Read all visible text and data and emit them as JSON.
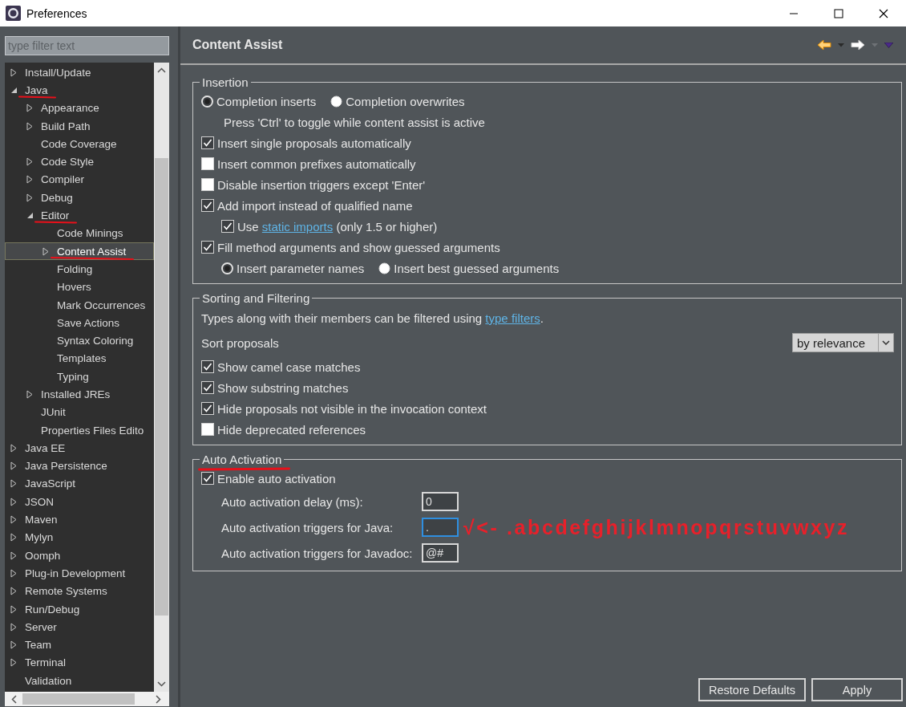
{
  "window": {
    "title": "Preferences"
  },
  "filter": {
    "placeholder": "type filter text"
  },
  "tree": {
    "items": [
      {
        "label": "Install/Update",
        "kind": "branch",
        "expanded": false,
        "selected": false
      },
      {
        "label": "Java",
        "kind": "branch",
        "expanded": true,
        "selected": false,
        "annotated": true,
        "children": [
          {
            "label": "Appearance",
            "kind": "branch",
            "expanded": false,
            "selected": false
          },
          {
            "label": "Build Path",
            "kind": "branch",
            "expanded": false,
            "selected": false
          },
          {
            "label": "Code Coverage",
            "kind": "leaf",
            "selected": false
          },
          {
            "label": "Code Style",
            "kind": "branch",
            "expanded": false,
            "selected": false
          },
          {
            "label": "Compiler",
            "kind": "branch",
            "expanded": false,
            "selected": false
          },
          {
            "label": "Debug",
            "kind": "branch",
            "expanded": false,
            "selected": false
          },
          {
            "label": "Editor",
            "kind": "branch",
            "expanded": true,
            "selected": false,
            "annotated": true,
            "children": [
              {
                "label": "Code Minings",
                "kind": "leaf",
                "selected": false
              },
              {
                "label": "Content Assist",
                "kind": "branch",
                "expanded": false,
                "selected": true,
                "annotated": true
              },
              {
                "label": "Folding",
                "kind": "leaf",
                "selected": false
              },
              {
                "label": "Hovers",
                "kind": "leaf",
                "selected": false
              },
              {
                "label": "Mark Occurrences",
                "kind": "leaf",
                "selected": false
              },
              {
                "label": "Save Actions",
                "kind": "leaf",
                "selected": false
              },
              {
                "label": "Syntax Coloring",
                "kind": "leaf",
                "selected": false
              },
              {
                "label": "Templates",
                "kind": "leaf",
                "selected": false
              },
              {
                "label": "Typing",
                "kind": "leaf",
                "selected": false
              }
            ]
          },
          {
            "label": "Installed JREs",
            "kind": "branch",
            "expanded": false,
            "selected": false
          },
          {
            "label": "JUnit",
            "kind": "leaf",
            "selected": false
          },
          {
            "label": "Properties Files Edito",
            "kind": "leaf",
            "selected": false
          }
        ]
      },
      {
        "label": "Java EE",
        "kind": "branch",
        "expanded": false,
        "selected": false
      },
      {
        "label": "Java Persistence",
        "kind": "branch",
        "expanded": false,
        "selected": false
      },
      {
        "label": "JavaScript",
        "kind": "branch",
        "expanded": false,
        "selected": false
      },
      {
        "label": "JSON",
        "kind": "branch",
        "expanded": false,
        "selected": false
      },
      {
        "label": "Maven",
        "kind": "branch",
        "expanded": false,
        "selected": false
      },
      {
        "label": "Mylyn",
        "kind": "branch",
        "expanded": false,
        "selected": false
      },
      {
        "label": "Oomph",
        "kind": "branch",
        "expanded": false,
        "selected": false
      },
      {
        "label": "Plug-in Development",
        "kind": "branch",
        "expanded": false,
        "selected": false
      },
      {
        "label": "Remote Systems",
        "kind": "branch",
        "expanded": false,
        "selected": false
      },
      {
        "label": "Run/Debug",
        "kind": "branch",
        "expanded": false,
        "selected": false
      },
      {
        "label": "Server",
        "kind": "branch",
        "expanded": false,
        "selected": false
      },
      {
        "label": "Team",
        "kind": "branch",
        "expanded": false,
        "selected": false
      },
      {
        "label": "Terminal",
        "kind": "branch",
        "expanded": false,
        "selected": false
      },
      {
        "label": "Validation",
        "kind": "leaf",
        "selected": false
      }
    ]
  },
  "page": {
    "title": "Content Assist",
    "groups": [
      {
        "title": "Insertion",
        "rows": [
          {
            "kind": "radio_group",
            "options": [
              {
                "label": "Completion inserts",
                "selected": true
              },
              {
                "label": "Completion overwrites",
                "selected": false
              }
            ],
            "children": [
              {
                "kind": "note",
                "text": "Press 'Ctrl' to toggle while content assist is active"
              }
            ]
          },
          {
            "kind": "checkbox",
            "label": "Insert single proposals automatically",
            "checked": true
          },
          {
            "kind": "checkbox",
            "label": "Insert common prefixes automatically",
            "checked": false
          },
          {
            "kind": "checkbox",
            "label": "Disable insertion triggers except 'Enter'",
            "checked": false
          },
          {
            "kind": "checkbox",
            "label": "Add import instead of qualified name",
            "checked": true,
            "children": [
              {
                "kind": "checkbox",
                "label": "Use",
                "link": "static imports",
                "suffix": " (only 1.5 or higher)",
                "checked": true
              }
            ]
          },
          {
            "kind": "checkbox",
            "label": "Fill method arguments and show guessed arguments",
            "checked": true,
            "children": [
              {
                "kind": "radio_group",
                "options": [
                  {
                    "label": "Insert parameter names",
                    "selected": true
                  },
                  {
                    "label": "Insert best guessed arguments",
                    "selected": false
                  }
                ]
              }
            ]
          }
        ]
      },
      {
        "title": "Sorting and Filtering",
        "rows": [
          {
            "kind": "text",
            "text": "Types along with their members can be filtered using",
            "link": "type filters",
            "suffix": "."
          },
          {
            "kind": "select",
            "label": "Sort proposals",
            "value": "by relevance"
          },
          {
            "kind": "checkbox",
            "label": "Show camel case matches",
            "checked": true
          },
          {
            "kind": "checkbox",
            "label": "Show substring matches",
            "checked": true
          },
          {
            "kind": "checkbox",
            "label": "Hide proposals not visible in the invocation context",
            "checked": true
          },
          {
            "kind": "checkbox",
            "label": "Hide deprecated references",
            "checked": false
          }
        ]
      },
      {
        "title": "Auto Activation",
        "annotated": true,
        "rows": [
          {
            "kind": "checkbox",
            "label": "Enable auto activation",
            "checked": true,
            "children": [
              {
                "kind": "field",
                "label": "Auto activation delay (ms):",
                "value": "0",
                "focused": false
              },
              {
                "kind": "field",
                "label": "Auto activation triggers for Java:",
                "value": ".",
                "focused": true,
                "annotation": "√<- .abcdefghijklmnopqrstuvwxyz"
              },
              {
                "kind": "field",
                "label": "Auto activation triggers for Javadoc:",
                "value": "@#",
                "focused": false
              }
            ]
          }
        ]
      }
    ]
  },
  "buttons": [
    {
      "label": "Restore Defaults"
    },
    {
      "label": "Apply"
    }
  ]
}
